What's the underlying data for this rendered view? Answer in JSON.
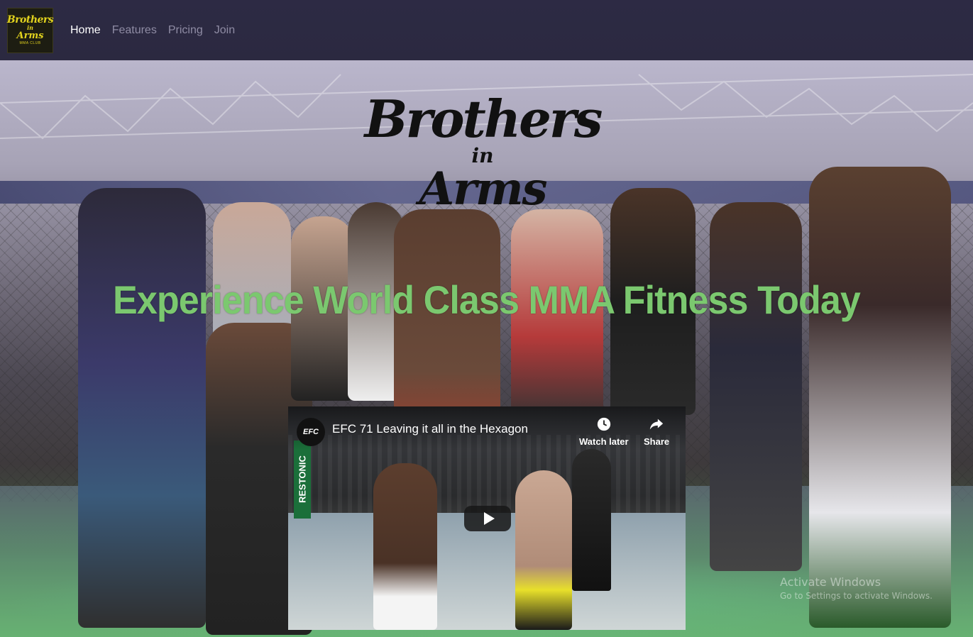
{
  "navbar": {
    "brand_logo_text": [
      "Brothers",
      "in",
      "Arms",
      "MMA CLUB"
    ],
    "links": [
      {
        "label": "Home",
        "active": true
      },
      {
        "label": "Features",
        "active": false
      },
      {
        "label": "Pricing",
        "active": false
      },
      {
        "label": "Join",
        "active": false
      }
    ]
  },
  "hero": {
    "logo_text": [
      "Brothers",
      "in",
      "Arms"
    ],
    "headline": "Experience World Class MMA Fitness Today"
  },
  "video": {
    "channel_icon": "EFC",
    "title": "EFC 71 Leaving it all in the Hexagon",
    "sponsor_text": "RESTONIC",
    "watch_later_label": "Watch later",
    "share_label": "Share",
    "watch_later_icon": "clock-icon",
    "share_icon": "share-arrow-icon",
    "play_icon": "play-icon"
  },
  "watermark": {
    "line1": "Activate Windows",
    "line2": "Go to Settings to activate Windows."
  },
  "colors": {
    "navbar_bg": "#2b2940",
    "headline": "#7bc86f",
    "nav_active": "#ffffff",
    "nav_inactive": "#8f8ca4"
  }
}
